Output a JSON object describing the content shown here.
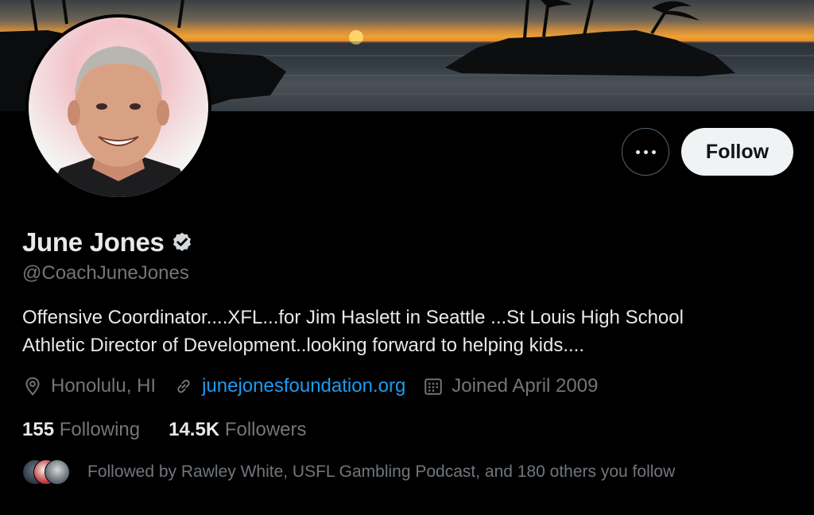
{
  "profile": {
    "name": "June Jones",
    "handle": "@CoachJuneJones",
    "bio_line1": "Offensive Coordinator....XFL...for Jim Haslett in Seattle ...St Louis High School",
    "bio_line2": "Athletic Director of Development..looking forward to helping kids....",
    "location": "Honolulu, HI",
    "website": "junejonesfoundation.org",
    "joined": "Joined April 2009"
  },
  "stats": {
    "following_count": "155",
    "following_label": "Following",
    "followers_count": "14.5K",
    "followers_label": "Followers"
  },
  "actions": {
    "follow_label": "Follow"
  },
  "followed_by": "Followed by Rawley White, USFL Gambling Podcast, and 180 others you follow",
  "colors": {
    "background": "#000000",
    "primary_text": "#e7e9ea",
    "secondary_text": "#71767b",
    "link": "#1d9bf0",
    "follow_button_bg": "#eff3f4"
  },
  "icons": [
    "more-icon",
    "verified-badge-icon",
    "location-icon",
    "link-icon",
    "calendar-icon"
  ]
}
